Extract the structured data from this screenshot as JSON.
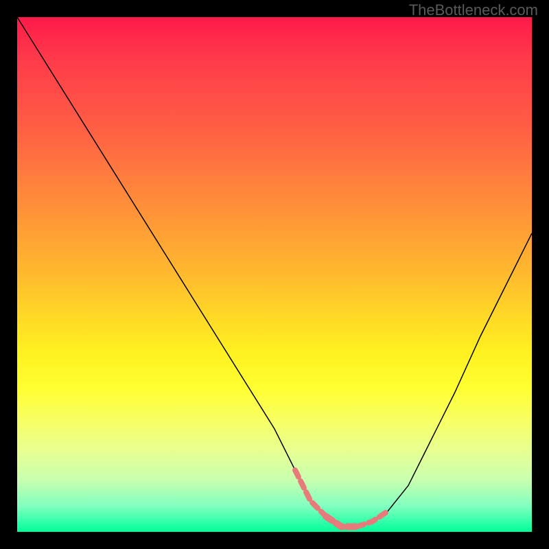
{
  "watermark": "TheBottleneck.com",
  "colors": {
    "background": "#000000",
    "dashed_stroke": "#e77a7a"
  },
  "chart_data": {
    "type": "line",
    "title": "",
    "xlabel": "",
    "ylabel": "",
    "xlim": [
      0,
      100
    ],
    "ylim": [
      0,
      100
    ],
    "grid": false,
    "series": [
      {
        "name": "bottleneck-curve",
        "x": [
          0,
          5,
          10,
          15,
          20,
          25,
          30,
          35,
          40,
          45,
          50,
          54,
          57,
          60,
          63,
          66,
          69,
          72,
          76,
          80,
          85,
          90,
          95,
          100
        ],
        "y": [
          100,
          92,
          84,
          76,
          68,
          60,
          52,
          44,
          36,
          28,
          20,
          12,
          6,
          3,
          1,
          1,
          2,
          4,
          9,
          17,
          27,
          38,
          48,
          58
        ]
      }
    ],
    "annotations": [
      {
        "name": "optimum-dashed-segment",
        "style": "dashed",
        "color": "#e77a7a",
        "x": [
          54,
          57,
          60,
          63,
          66,
          69,
          72
        ],
        "y": [
          12,
          6,
          3,
          1,
          1,
          2,
          4
        ]
      }
    ]
  }
}
